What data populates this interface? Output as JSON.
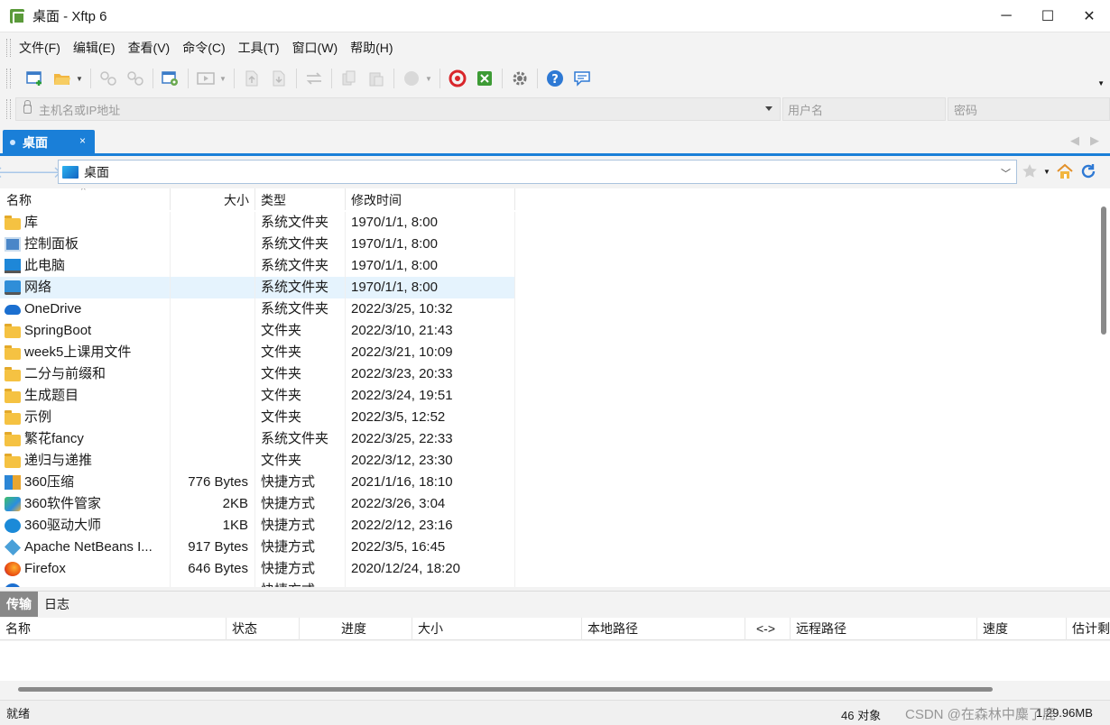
{
  "window": {
    "title": "桌面 - Xftp 6",
    "minimize": "─",
    "maximize": "☐",
    "close": "✕"
  },
  "menu": [
    "文件(F)",
    "编辑(E)",
    "查看(V)",
    "命令(C)",
    "工具(T)",
    "窗口(W)",
    "帮助(H)"
  ],
  "host_bar": {
    "host_placeholder": "主机名或IP地址",
    "user_placeholder": "用户名",
    "password_placeholder": "密码"
  },
  "session_tab": {
    "label": "桌面",
    "close": "×"
  },
  "path_bar": {
    "path": "桌面"
  },
  "file_list": {
    "columns": {
      "name": "名称",
      "size": "大小",
      "type": "类型",
      "modified": "修改时间"
    },
    "rows": [
      {
        "icon": "folder",
        "name": "库",
        "size": "",
        "type": "系统文件夹",
        "modified": "1970/1/1, 8:00"
      },
      {
        "icon": "ctrl",
        "name": "控制面板",
        "size": "",
        "type": "系统文件夹",
        "modified": "1970/1/1, 8:00"
      },
      {
        "icon": "pc",
        "name": "此电脑",
        "size": "",
        "type": "系统文件夹",
        "modified": "1970/1/1, 8:00"
      },
      {
        "icon": "net",
        "name": "网络",
        "size": "",
        "type": "系统文件夹",
        "modified": "1970/1/1, 8:00"
      },
      {
        "icon": "cloud",
        "name": "OneDrive",
        "size": "",
        "type": "系统文件夹",
        "modified": "2022/3/25, 10:32"
      },
      {
        "icon": "folder",
        "name": "SpringBoot",
        "size": "",
        "type": "文件夹",
        "modified": "2022/3/10, 21:43"
      },
      {
        "icon": "folder",
        "name": "week5上课用文件",
        "size": "",
        "type": "文件夹",
        "modified": "2022/3/21, 10:09"
      },
      {
        "icon": "folder",
        "name": "二分与前缀和",
        "size": "",
        "type": "文件夹",
        "modified": "2022/3/23, 20:33"
      },
      {
        "icon": "folder",
        "name": "生成题目",
        "size": "",
        "type": "文件夹",
        "modified": "2022/3/24, 19:51"
      },
      {
        "icon": "folder",
        "name": "示例",
        "size": "",
        "type": "文件夹",
        "modified": "2022/3/5, 12:52"
      },
      {
        "icon": "folder",
        "name": "繁花fancy",
        "size": "",
        "type": "系统文件夹",
        "modified": "2022/3/25, 22:33"
      },
      {
        "icon": "folder",
        "name": "递归与递推",
        "size": "",
        "type": "文件夹",
        "modified": "2022/3/12, 23:30"
      },
      {
        "icon": "zip",
        "name": "360压缩",
        "size": "776 Bytes",
        "type": "快捷方式",
        "modified": "2021/1/16, 18:10"
      },
      {
        "icon": "mgr",
        "name": "360软件管家",
        "size": "2KB",
        "type": "快捷方式",
        "modified": "2022/3/26, 3:04"
      },
      {
        "icon": "drv",
        "name": "360驱动大师",
        "size": "1KB",
        "type": "快捷方式",
        "modified": "2022/2/12, 23:16"
      },
      {
        "icon": "nb",
        "name": "Apache NetBeans I...",
        "size": "917 Bytes",
        "type": "快捷方式",
        "modified": "2022/3/5, 16:45"
      },
      {
        "icon": "ff",
        "name": "Firefox",
        "size": "646 Bytes",
        "type": "快捷方式",
        "modified": "2020/12/24, 18:20"
      },
      {
        "icon": "partial",
        "name": "",
        "size": "",
        "type": "快捷方式",
        "modified": ""
      }
    ]
  },
  "bottom_tabs": [
    "传输",
    "日志"
  ],
  "transfer_columns": [
    "名称",
    "状态",
    "进度",
    "大小",
    "本地路径",
    "<->",
    "远程路径",
    "速度",
    "估计剩"
  ],
  "status": {
    "text": "就绪",
    "count": "46 对象",
    "size": "1.29.96MB"
  },
  "watermark": "CSDN @在森林中麋了鹿",
  "colors": {
    "accent": "#1a7fd8",
    "selection": "#e5f3fd"
  }
}
